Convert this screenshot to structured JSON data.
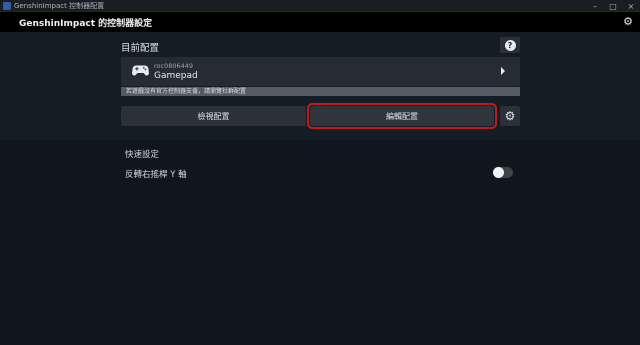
{
  "window": {
    "title": "GenshinImpact 控制器配置",
    "controls": {
      "minimize": "–",
      "maximize": "□",
      "close": "×"
    }
  },
  "header": {
    "title": "GenshinImpact 的控制器設定",
    "settings_icon": "gear-icon"
  },
  "current_config": {
    "section_title": "目前配置",
    "help_icon": "help-icon",
    "help_glyph": "?",
    "card": {
      "icon": "gamepad-icon",
      "user": "roc0806449",
      "device": "Gamepad",
      "chevron_icon": "chevron-right-icon"
    },
    "notice": "若遊戲沒有官方控制器支援，請瀏覽社群配置",
    "browse_button": "檢視配置",
    "edit_button": "編輯配置",
    "config_settings_icon": "gear-icon",
    "highlight_color": "#c8171b"
  },
  "quick_settings": {
    "title": "快速設定",
    "invert_right_stick_y": {
      "label": "反轉右搖桿 Y 軸",
      "enabled": false
    }
  }
}
